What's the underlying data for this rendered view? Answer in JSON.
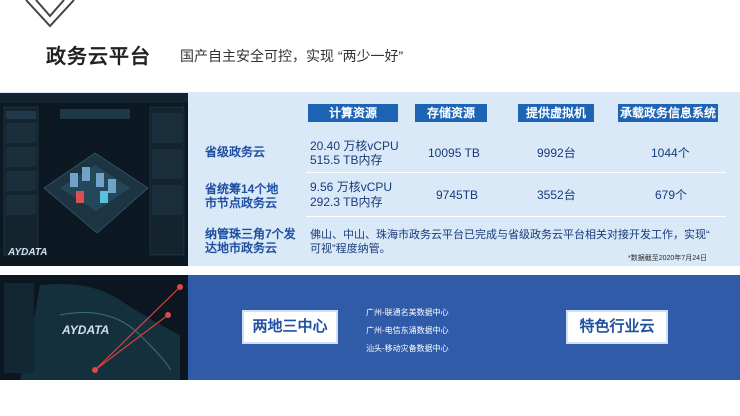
{
  "header": {
    "title": "政务云平台",
    "subtitle": "国产自主安全可控，实现 “两少一好”"
  },
  "table": {
    "columns": [
      "计算资源",
      "存储资源",
      "提供虚拟机",
      "承载政务信息系统"
    ],
    "rows": [
      {
        "label": "省级政务云",
        "compute_1": "20.40   万核vCPU",
        "compute_2": "515.5   TB内存",
        "storage": "10095 TB",
        "vms": "9992台",
        "systems": "1044个"
      },
      {
        "label_1": "省统筹14个地",
        "label_2": "市节点政务云",
        "compute_1": "9.56  万核vCPU",
        "compute_2": "292.3   TB内存",
        "storage": "9745TB",
        "vms": "3552台",
        "systems": "679个"
      },
      {
        "label_1": "纳管珠三角7个发",
        "label_2": "达地市政务云",
        "text_1": "佛山、中山、珠海市政务云平台已完成与省级政务云平台相关对接开发工作，实现“",
        "text_2": "可视”程度纳管。"
      }
    ],
    "note": "*数据截至2020年7月24日"
  },
  "screenshot_top": {
    "brand": "AYDATA"
  },
  "screenshot_bottom": {
    "brand": "AYDATA"
  },
  "bottom": {
    "left_box": "两地三中心",
    "right_box": "特色行业云",
    "datacenters": [
      "广州-联通名美数据中心",
      "广州-电信东涌数据中心",
      "汕头-移动灾备数据中心"
    ]
  }
}
